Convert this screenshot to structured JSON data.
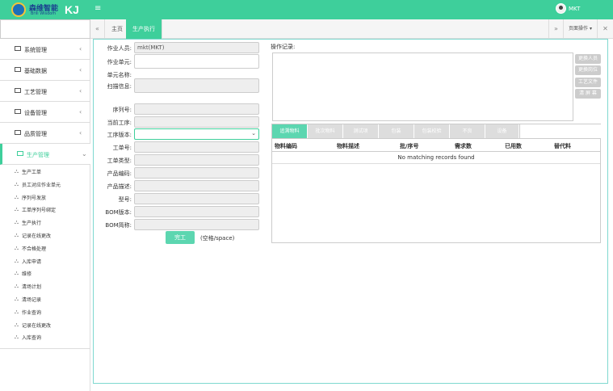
{
  "app": {
    "logo_cn": "森维智能",
    "logo_en": "Brill Wisdom",
    "brand": "KJ",
    "menu_toggle": "≡",
    "username": "MKT"
  },
  "sidebar": {
    "menus": [
      {
        "label": "系统管理",
        "arrow": "‹"
      },
      {
        "label": "基础数据",
        "arrow": "‹"
      },
      {
        "label": "工艺管理",
        "arrow": "‹"
      },
      {
        "label": "设备管理",
        "arrow": "‹"
      },
      {
        "label": "品质管理",
        "arrow": "‹"
      }
    ],
    "active_menu": {
      "label": "生产管理",
      "arrow": "⌄"
    },
    "sub_items": [
      "生产工单",
      "员工对应作业单元",
      "序列号发放",
      "工单序列号绑定",
      "生产执行",
      "记录在线更改",
      "不合格处理",
      "入库申请",
      "维修",
      "清场计划",
      "清场记录",
      "作业查询",
      "记录在线更改",
      "入库查询"
    ]
  },
  "tabs": {
    "nav_left": "«",
    "home": "主页",
    "current": "生产执行",
    "nav_right": "»",
    "page_ops": "页面操作 ▾",
    "close_all": "✕"
  },
  "form": {
    "operator_label": "作业人员:",
    "operator_value": "mkt(MKT)",
    "unit_label": "作业单元:",
    "unit_name_label": "单元名称:",
    "scan_label": "扫描信息:",
    "serial_label": "序列号:",
    "current_step_label": "当前工序:",
    "route_version_label": "工序版本:",
    "work_order_label": "工单号:",
    "order_type_label": "工单类型:",
    "product_code_label": "产品编码:",
    "product_desc_label": "产品描述:",
    "model_label": "型号:",
    "bom_version_label": "BOM版本:",
    "bom_short_label": "BOM简称:",
    "complete_button": "完工",
    "hint": "(空格/space)"
  },
  "oplog": {
    "label": "操作记录:",
    "buttons": [
      "更换人员",
      "更换岗位",
      "工艺文件",
      "清 屏 幕"
    ]
  },
  "grid": {
    "tabs": [
      "追溯物料",
      "批次物料",
      "测试项",
      "包装",
      "包装校验",
      "不良",
      "设备"
    ],
    "columns": [
      "物料编码",
      "物料描述",
      "批/序号",
      "需求数",
      "已用数",
      "替代料"
    ],
    "empty_text": "No matching records found"
  },
  "colors": {
    "accent": "#3ecf9b",
    "button_green": "#5cd6b0",
    "disabled_button": "#cccccc"
  }
}
